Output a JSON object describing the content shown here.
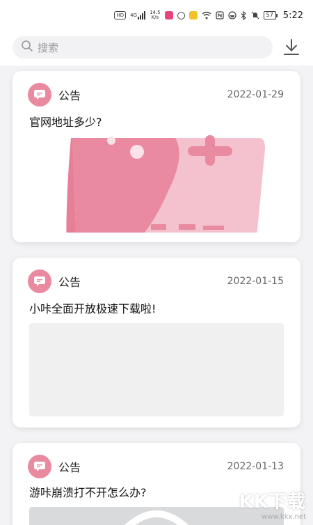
{
  "status_bar": {
    "hd": "HD",
    "network": "4G",
    "speed_top": "14.5",
    "speed_bottom": "K/s",
    "battery": "57",
    "time": "5:22"
  },
  "search": {
    "placeholder": "搜索"
  },
  "notices": [
    {
      "label": "公告",
      "date": "2022-01-29",
      "title": "官网地址多少?"
    },
    {
      "label": "公告",
      "date": "2022-01-15",
      "title": "小咔全面开放极速下载啦!"
    },
    {
      "label": "公告",
      "date": "2022-01-13",
      "title": "游咔崩溃打不开怎么办?"
    }
  ],
  "watermark": {
    "brand": "KK下载",
    "url": "www.kkx.net"
  },
  "colors": {
    "accent": "#e98aa0",
    "background": "#f3f3f5"
  }
}
